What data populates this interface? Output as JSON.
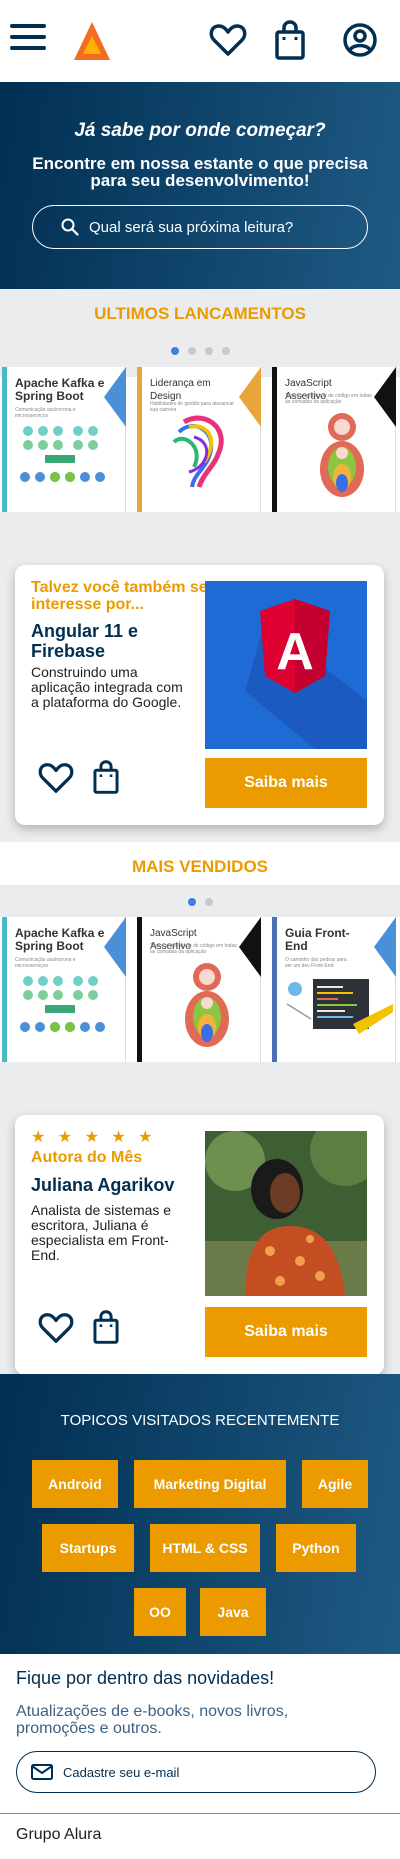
{
  "header": {
    "menu_icon": "hamburger-icon",
    "logo_icon": "alura-triangle-logo",
    "favorites_icon": "heart-icon",
    "bag_icon": "shopping-bag-icon",
    "profile_icon": "user-circle-icon"
  },
  "banner": {
    "title": "Já sabe por onde começar?",
    "subtitle": "Encontre em nossa estante o que precisa para seu desenvolvimento!",
    "search_placeholder": "Qual será sua próxima leitura?"
  },
  "latest": {
    "title": "ULTIMOS LANCAMENTOS",
    "dots": 4,
    "active_dot": 1,
    "books": [
      {
        "title": "Apache Kafka e Spring Boot",
        "subtitle": "Comunicação assíncrona e microsserviços",
        "color": "#4bb7c7",
        "corner": "#4a90d9"
      },
      {
        "title": "Liderança em Design",
        "subtitle": "Habilidades de gestão para alavancar sua carreira",
        "color": "#e8a53a",
        "corner": "#e8a53a"
      },
      {
        "title": "JavaScript Assertivo",
        "subtitle": "Testes e qualidade de código em todas as camadas da aplicação",
        "color": "#111111",
        "corner": "#111111"
      }
    ]
  },
  "recommend": {
    "kicker": "Talvez você também se interesse por...",
    "title": "Angular 11 e Firebase",
    "description": "Construindo uma aplicação integrada com a plataforma do Google.",
    "button": "Saiba mais",
    "image_letter": "A"
  },
  "bestsellers": {
    "title": "MAIS VENDIDOS",
    "dots": 2,
    "active_dot": 1,
    "books": [
      {
        "title": "Apache Kafka e Spring Boot",
        "subtitle": "Comunicação assíncrona e microsserviços",
        "color": "#4bb7c7",
        "corner": "#4a90d9"
      },
      {
        "title": "JavaScript Assertivo",
        "subtitle": "Testes e qualidade de código em todas as camadas da aplicação",
        "color": "#111111",
        "corner": "#111111"
      },
      {
        "title": "Guia Front-End",
        "subtitle": "O caminho das pedras para ser um dev Front-End",
        "color": "#4a6fb5",
        "corner": "#4a90d9"
      }
    ]
  },
  "author": {
    "stars": "★ ★ ★ ★ ★",
    "kicker": "Autora do Mês",
    "name": "Juliana Agarikov",
    "description": "Analista de sistemas e escritora, Juliana é especialista em Front-End.",
    "button": "Saiba mais"
  },
  "topics": {
    "title": "TOPICOS VISITADOS RECENTEMENTE",
    "tags": [
      "Android",
      "Marketing Digital",
      "Agile",
      "Startups",
      "HTML & CSS",
      "Python",
      "OO",
      "Java"
    ]
  },
  "newsletter": {
    "title": "Fique por dentro das novidades!",
    "text": "Atualizações de e-books, novos livros, promoções e outros.",
    "email_placeholder": "Cadastre seu e-mail"
  },
  "footer": {
    "text": "Grupo Alura"
  },
  "colors": {
    "primary": "#002f52",
    "accent": "#eb9b00",
    "dot_active": "#3d7fe0"
  }
}
